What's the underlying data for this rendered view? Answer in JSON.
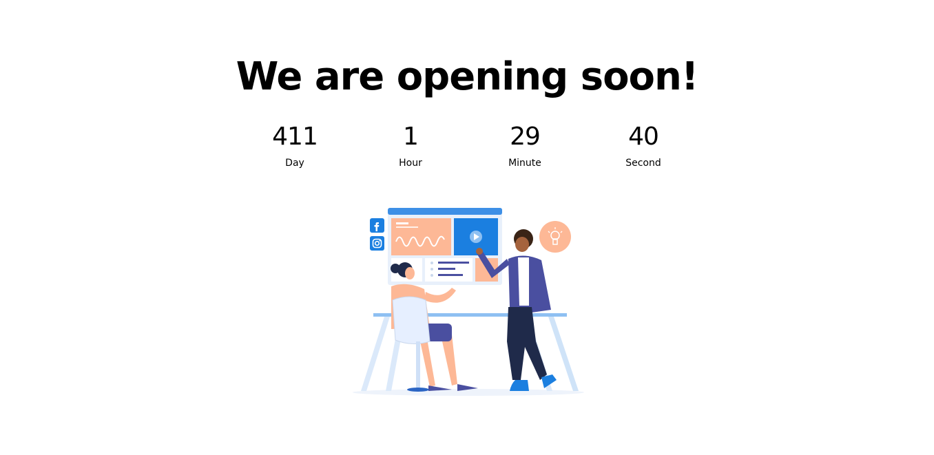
{
  "heading": "We are opening soon!",
  "countdown": {
    "days": {
      "value": "411",
      "label": "Day"
    },
    "hours": {
      "value": "1",
      "label": "Hour"
    },
    "minutes": {
      "value": "29",
      "label": "Minute"
    },
    "seconds": {
      "value": "40",
      "label": "Second"
    }
  },
  "illustration": {
    "social_icons": [
      "facebook-icon",
      "instagram-icon"
    ],
    "colors": {
      "accent_blue": "#1b7fe0",
      "peach": "#fdb896",
      "navy": "#4a4fa0"
    }
  }
}
